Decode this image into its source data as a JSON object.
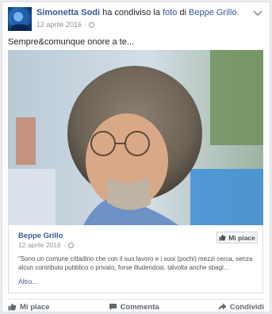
{
  "post": {
    "author": "Simonetta Sodi",
    "action_text": "ha condiviso la",
    "object_link": "foto",
    "of_text": "di",
    "source_link": "Beppe Grillo.",
    "date": "12 aprile 2016",
    "privacy_icon": "globe-icon",
    "menu_icon": "chevron-down-icon",
    "message": "Sempre&comunque onore a te..."
  },
  "shared": {
    "page_name": "Beppe Grillo",
    "date": "12 aprile 2016",
    "like_button": "Mi piace",
    "quote": "\"Sono un comune cittadino che con il suo lavoro e i suoi (pochi) mezzi cerca, senza alcun contributo pubblico o privato, forse illudendosi, talvolta anche sbagl...",
    "more": "Altro..."
  },
  "actions": [
    {
      "label": "Mi piace",
      "icon": "thumbs-up-icon"
    },
    {
      "label": "Commenta",
      "icon": "comment-icon"
    },
    {
      "label": "Condividi",
      "icon": "share-icon"
    }
  ],
  "colors": {
    "link": "#365899",
    "text": "#1d2129",
    "muted": "#90949c",
    "background": "#e9ebee"
  }
}
